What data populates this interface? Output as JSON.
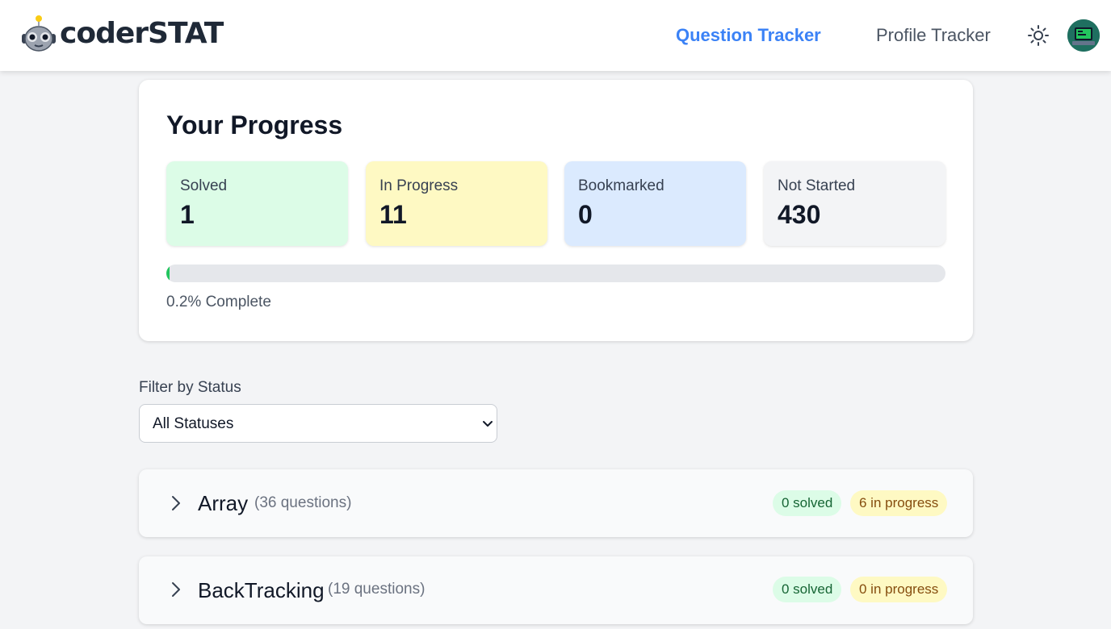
{
  "brand": {
    "name": "coderSTAT"
  },
  "nav": {
    "question_tracker": "Question Tracker",
    "profile_tracker": "Profile Tracker",
    "theme_icon": "sun-icon"
  },
  "progress": {
    "title": "Your Progress",
    "stats": [
      {
        "label": "Solved",
        "value": "1",
        "color": "#dcfce7"
      },
      {
        "label": "In Progress",
        "value": "11",
        "color": "#fef9c3"
      },
      {
        "label": "Bookmarked",
        "value": "0",
        "color": "#dbeafe"
      },
      {
        "label": "Not Started",
        "value": "430",
        "color": "#f3f4f6"
      }
    ],
    "percent_complete": 0.2,
    "complete_text": "0.2% Complete",
    "bar_color": "#22c55e"
  },
  "filter": {
    "label": "Filter by Status",
    "selected": "All Statuses"
  },
  "topics": [
    {
      "name": "Array",
      "count": "(36 questions)",
      "solved": "0 solved",
      "in_progress": "6 in progress"
    },
    {
      "name": "BackTracking",
      "count": "(19 questions)",
      "solved": "0 solved",
      "in_progress": "0 in progress"
    }
  ]
}
